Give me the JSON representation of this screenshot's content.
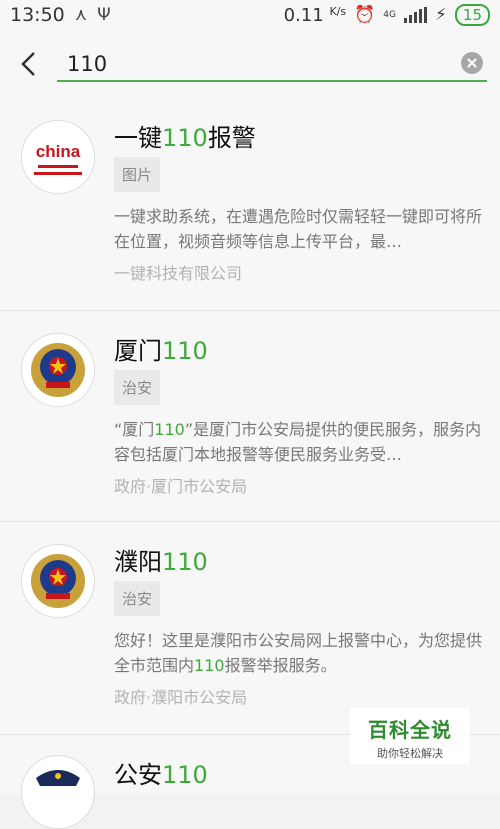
{
  "status_bar": {
    "time": "13:50",
    "speed": "0.11",
    "speed_unit": "K/s",
    "network": "4G",
    "battery": "15"
  },
  "search": {
    "query": "110",
    "back_icon": "chevron-left-icon",
    "clear_icon": "clear-circle-icon"
  },
  "accent_color": "#3daa3a",
  "results": [
    {
      "title_prefix": "一键",
      "title_highlight": "110",
      "title_suffix": "报警",
      "tag": "图片",
      "desc_prefix": "一键求助系统，在遭遇危险时仅需轻轻一键即可将所在位置，视频音频等信息上传平台，最…",
      "desc_highlight": "",
      "desc_suffix": "",
      "source": "一键科技有限公司",
      "avatar_text": "china"
    },
    {
      "title_prefix": "厦门",
      "title_highlight": "110",
      "title_suffix": "",
      "tag": "治安",
      "desc_prefix": "“厦门",
      "desc_highlight": "110",
      "desc_suffix": "”是厦门市公安局提供的便民服务，服务内容包括厦门本地报警等便民服务业务受…",
      "source": "政府·厦门市公安局"
    },
    {
      "title_prefix": "濮阳",
      "title_highlight": "110",
      "title_suffix": "",
      "tag": "治安",
      "desc_prefix": "您好！这里是濮阳市公安局网上报警中心，为您提供全市范围内",
      "desc_highlight": "110",
      "desc_suffix": "报警举报服务。",
      "source": "政府·濮阳市公安局"
    },
    {
      "title_prefix": "公安",
      "title_highlight": "110",
      "title_suffix": ""
    }
  ],
  "watermark": {
    "title": "百科全说",
    "subtitle": "助你轻松解决"
  }
}
